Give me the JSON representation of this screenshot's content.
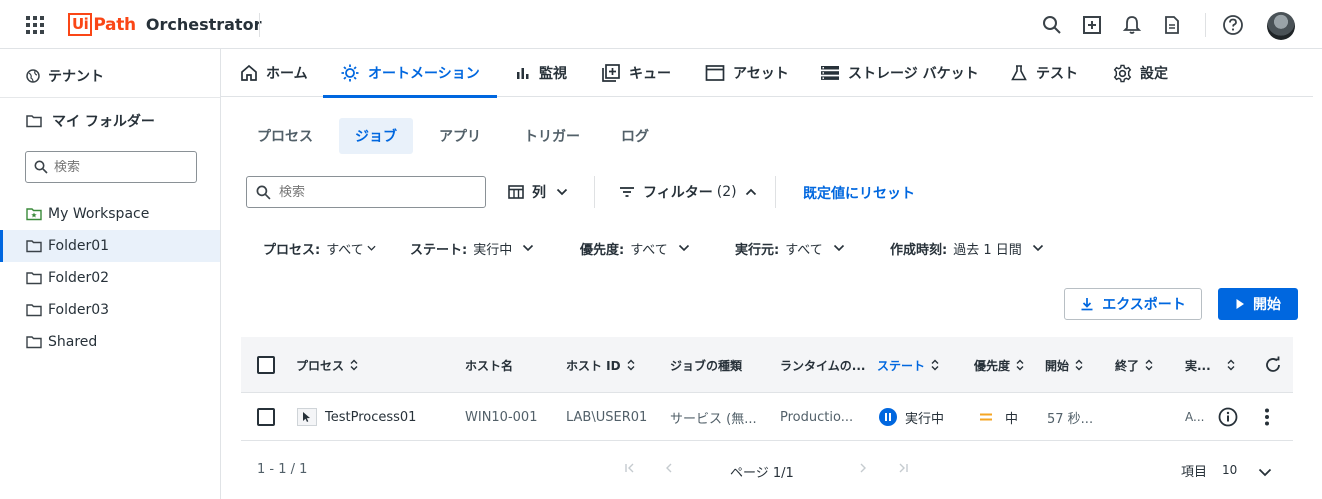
{
  "app": {
    "logo_ui": "Ui",
    "logo_path": "Path",
    "product": "Orchestrator"
  },
  "sidebar": {
    "tenant": "テナント",
    "my_folders": "マイ フォルダー",
    "search_placeholder": "検索",
    "items": [
      {
        "label": "My Workspace"
      },
      {
        "label": "Folder01"
      },
      {
        "label": "Folder02"
      },
      {
        "label": "Folder03"
      },
      {
        "label": "Shared"
      }
    ]
  },
  "nav": {
    "tabs": [
      {
        "label": "ホーム"
      },
      {
        "label": "オートメーション"
      },
      {
        "label": "監視"
      },
      {
        "label": "キュー"
      },
      {
        "label": "アセット"
      },
      {
        "label": "ストレージ バケット"
      },
      {
        "label": "テスト"
      },
      {
        "label": "設定"
      }
    ]
  },
  "subtabs": [
    {
      "label": "プロセス"
    },
    {
      "label": "ジョブ"
    },
    {
      "label": "アプリ"
    },
    {
      "label": "トリガー"
    },
    {
      "label": "ログ"
    }
  ],
  "toolbar": {
    "search_placeholder": "検索",
    "columns_label": "列",
    "filter_label": "フィルター",
    "filter_count": "(2)",
    "reset_label": "既定値にリセット"
  },
  "filters": [
    {
      "name": "プロセス:",
      "value": "すべて"
    },
    {
      "name": "ステート:",
      "value": "実行中"
    },
    {
      "name": "優先度:",
      "value": "すべて"
    },
    {
      "name": "実行元:",
      "value": "すべて"
    },
    {
      "name": "作成時刻:",
      "value": "過去 1 日間"
    }
  ],
  "actions": {
    "export_label": "エクスポート",
    "start_label": "開始"
  },
  "table": {
    "headers": {
      "process": "プロセス",
      "host": "ホスト名",
      "hostid": "ホスト ID",
      "jobtype": "ジョブの種類",
      "runtime": "ランタイムの...",
      "state": "ステート",
      "priority": "優先度",
      "start": "開始",
      "end": "終了",
      "exec": "実..."
    },
    "rows": [
      {
        "process": "TestProcess01",
        "host": "WIN10-001",
        "hostid": "LAB\\USER01",
        "jobtype": "サービス (無...",
        "runtime": "Productio...",
        "state": "実行中",
        "priority": "中",
        "start": "57 秒...",
        "exec": "A..."
      }
    ]
  },
  "footer": {
    "count": "1 - 1 / 1",
    "page": "ページ 1/1",
    "items_label": "項目",
    "items_value": "10"
  },
  "colors": {
    "accent": "#0067df",
    "brand": "#fa4616",
    "priority_medium": "#f5a623"
  }
}
